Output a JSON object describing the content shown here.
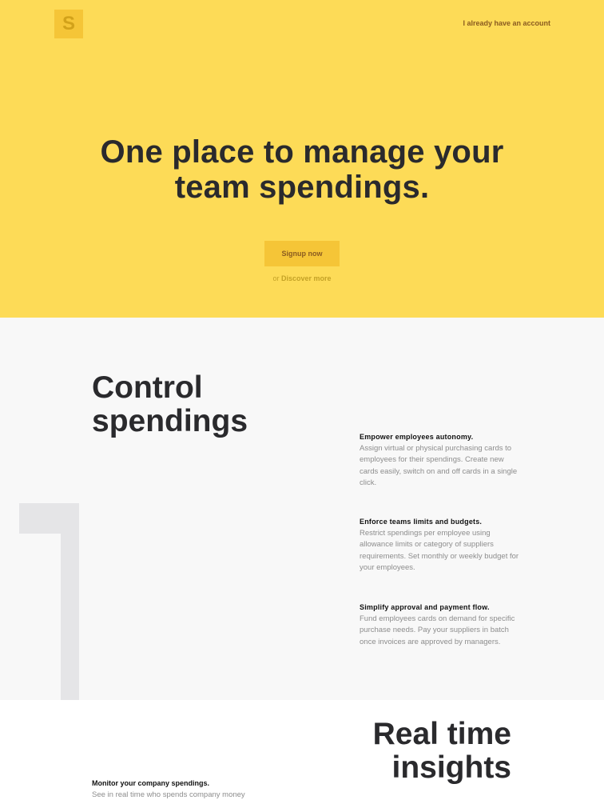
{
  "brand": {
    "logo_letter": "S"
  },
  "header": {
    "account_link": "I already have an account"
  },
  "hero": {
    "title_line1": "One place to manage your",
    "title_line2": "team spendings.",
    "signup_label": "Signup now",
    "discover_prefix": "or",
    "discover_link": "Discover more"
  },
  "control": {
    "title_line1": "Control",
    "title_line2": "spendings",
    "number": "1",
    "features": [
      {
        "title": "Empower employees autonomy.",
        "text": "Assign virtual or physical purchasing cards to employees for their spendings. Create new cards easily, switch on and off cards in a single click."
      },
      {
        "title": "Enforce teams limits and budgets.",
        "text": "Restrict spendings per employee using allowance limits or category of suppliers requirements. Set monthly or weekly budget for your employees."
      },
      {
        "title": "Simplify approval and payment flow.",
        "text": "Fund employees cards on demand for specific purchase needs. Pay your suppliers in batch once invoices are approved by managers."
      }
    ]
  },
  "insights": {
    "title_line1": "Real time",
    "title_line2": "insights",
    "monitor_title": "Monitor your company spendings.",
    "monitor_text": "See in real time who spends company money"
  },
  "colors": {
    "hero_bg": "#fddb57",
    "accent": "#f5c537",
    "link": "#8a5b20",
    "section_bg": "#f8f8f8"
  }
}
